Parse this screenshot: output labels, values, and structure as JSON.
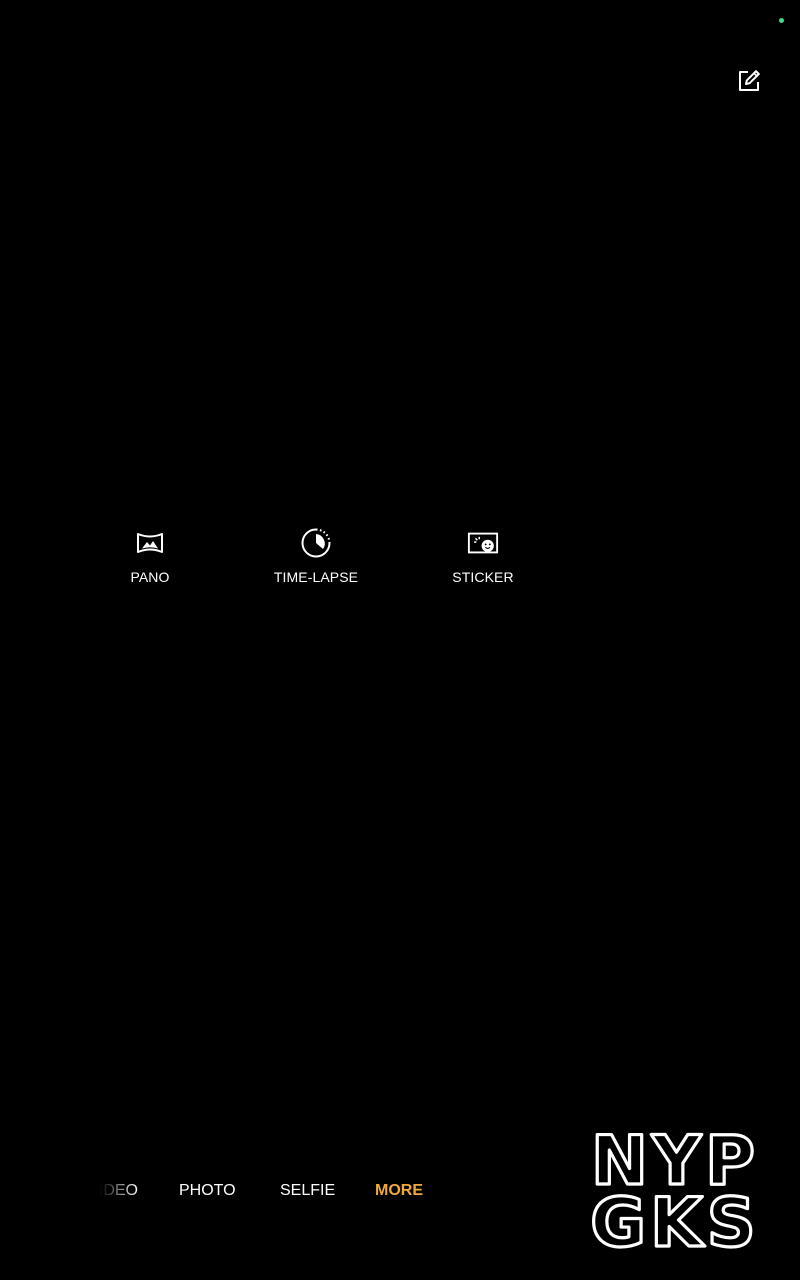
{
  "colors": {
    "background": "#000000",
    "text": "#ffffff",
    "accent": "#f2a93b",
    "status_dot": "#3ddc84"
  },
  "toolbar": {
    "edit_icon": "edit-square-icon"
  },
  "more_modes": [
    {
      "label": "PANO",
      "icon": "panorama-icon"
    },
    {
      "label": "TIME-LAPSE",
      "icon": "time-lapse-icon"
    },
    {
      "label": "STICKER",
      "icon": "sticker-icon"
    }
  ],
  "mode_bar": {
    "tabs": [
      {
        "label": "VIDEO",
        "active": false
      },
      {
        "label": "PHOTO",
        "active": false
      },
      {
        "label": "SELFIE",
        "active": false
      },
      {
        "label": "MORE",
        "active": true
      }
    ]
  },
  "watermark": {
    "text_line1": "NYP",
    "text_line2": "GKS"
  }
}
